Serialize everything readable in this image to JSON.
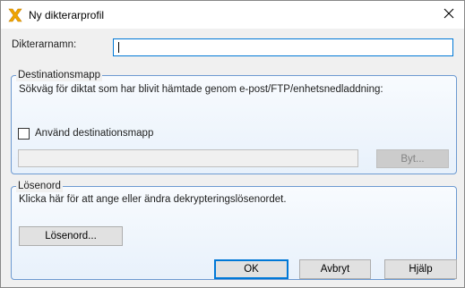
{
  "window": {
    "title": "Ny dikterarprofil"
  },
  "author_name": {
    "label": "Dikterarnamn:",
    "value": ""
  },
  "destination": {
    "group_title": "Destinationsmapp",
    "description": "Sökväg för diktat som har blivit hämtade genom e-post/FTP/enhetsnedladdning:",
    "checkbox_label": "Använd destinationsmapp",
    "checkbox_checked": false,
    "path_value": "",
    "change_button": "Byt..."
  },
  "password": {
    "group_title": "Lösenord",
    "description": "Klicka här för att ange eller ändra dekrypteringslösenordet.",
    "button": "Lösenord..."
  },
  "footer": {
    "ok": "OK",
    "cancel": "Avbryt",
    "help": "Hjälp"
  },
  "colors": {
    "accent": "#0078d7",
    "group_border": "#6d9ad1",
    "app_icon": "#f0a500"
  },
  "icons": {
    "app": "x-logo-icon",
    "close": "close-icon"
  }
}
